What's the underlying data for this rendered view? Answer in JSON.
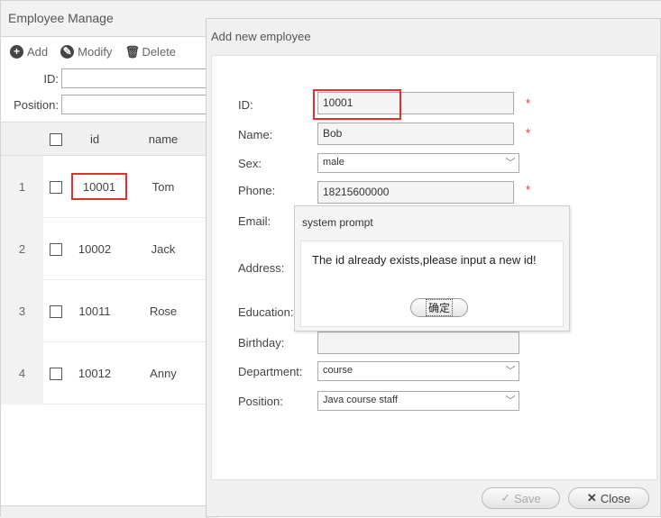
{
  "left": {
    "title": "Employee Manage",
    "toolbar": {
      "add": "Add",
      "modify": "Modify",
      "delete": "Delete"
    },
    "filters": {
      "id_label": "ID:",
      "position_label": "Position:"
    },
    "grid": {
      "headers": {
        "id": "id",
        "name": "name"
      },
      "rows": [
        {
          "num": "1",
          "id": "10001",
          "name": "Tom"
        },
        {
          "num": "2",
          "id": "10002",
          "name": "Jack"
        },
        {
          "num": "3",
          "id": "10011",
          "name": "Rose"
        },
        {
          "num": "4",
          "id": "10012",
          "name": "Anny"
        }
      ]
    }
  },
  "dialog": {
    "title": "Add new employee",
    "fields": {
      "id_label": "ID:",
      "id_value": "10001",
      "name_label": "Name:",
      "name_value": "Bob",
      "sex_label": "Sex:",
      "sex_value": "male",
      "phone_label": "Phone:",
      "phone_value": "18215600000",
      "email_label": "Email:",
      "address_label": "Address:",
      "education_label": "Education:",
      "birthday_label": "Birthday:",
      "department_label": "Department:",
      "department_value": "course",
      "position_label": "Position:",
      "position_value": "Java course staff"
    },
    "required_mark": "*",
    "buttons": {
      "save": "Save",
      "close": "Close"
    }
  },
  "prompt": {
    "title": "system prompt",
    "message": "The id already exists,please input a new id!",
    "ok": "确定"
  },
  "colors": {
    "highlight": "#e03030",
    "required": "#e03030"
  }
}
